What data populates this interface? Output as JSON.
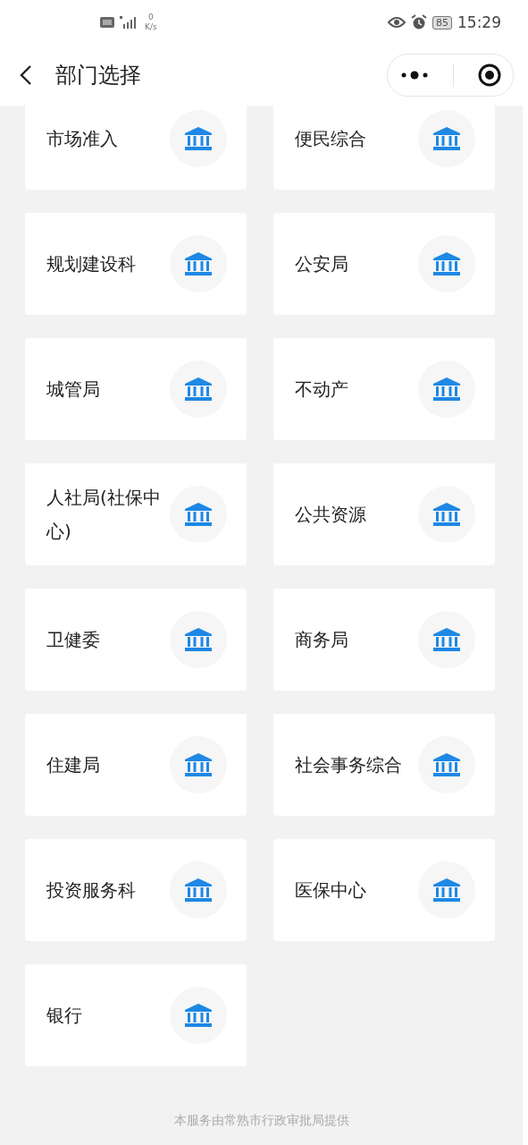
{
  "status_bar": {
    "speed_value": "0",
    "speed_unit": "K/s",
    "battery": "85",
    "time": "15:29"
  },
  "header": {
    "title": "部门选择"
  },
  "departments": [
    {
      "name": "市场准入"
    },
    {
      "name": "便民综合"
    },
    {
      "name": "规划建设科"
    },
    {
      "name": "公安局"
    },
    {
      "name": "城管局"
    },
    {
      "name": "不动产"
    },
    {
      "name": "人社局(社保中心)"
    },
    {
      "name": "公共资源"
    },
    {
      "name": "卫健委"
    },
    {
      "name": "商务局"
    },
    {
      "name": "住建局"
    },
    {
      "name": "社会事务综合"
    },
    {
      "name": "投资服务科"
    },
    {
      "name": "医保中心"
    },
    {
      "name": "银行"
    }
  ],
  "footer": "本服务由常熟市行政审批局提供"
}
